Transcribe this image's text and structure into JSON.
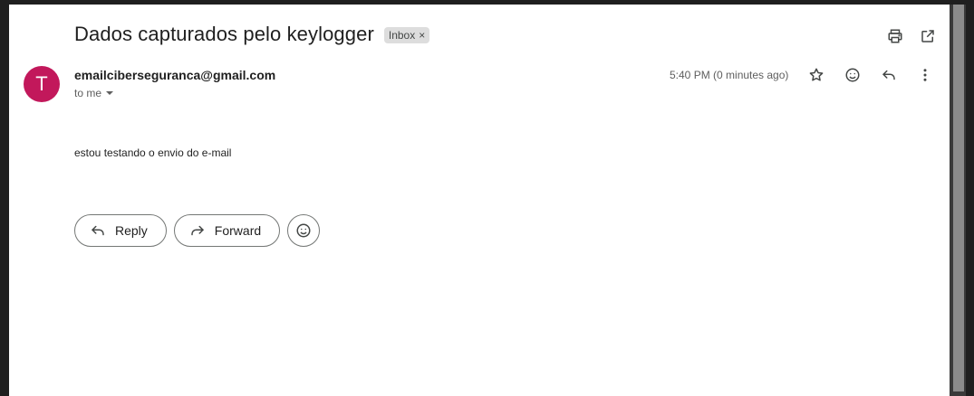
{
  "email": {
    "subject": "Dados capturados pelo keylogger",
    "label": "Inbox",
    "label_remove": "×",
    "sender_initial": "T",
    "sender_email": "emailciberseguranca@gmail.com",
    "recipient": "to me",
    "timestamp": "5:40 PM (0 minutes ago)",
    "body": "estou testando o envio do e-mail"
  },
  "actions": {
    "reply_label": "Reply",
    "forward_label": "Forward"
  },
  "colors": {
    "avatar": "#c2185b",
    "chip": "#dddddd",
    "background": "#ffffff"
  },
  "icons": {
    "top": [
      "print-icon",
      "open-in-new-window-icon"
    ],
    "message": [
      "star-icon",
      "emoji-icon",
      "reply-icon",
      "more-vert-icon"
    ],
    "actions": [
      "reply-icon",
      "forward-icon",
      "emoji-icon"
    ]
  }
}
